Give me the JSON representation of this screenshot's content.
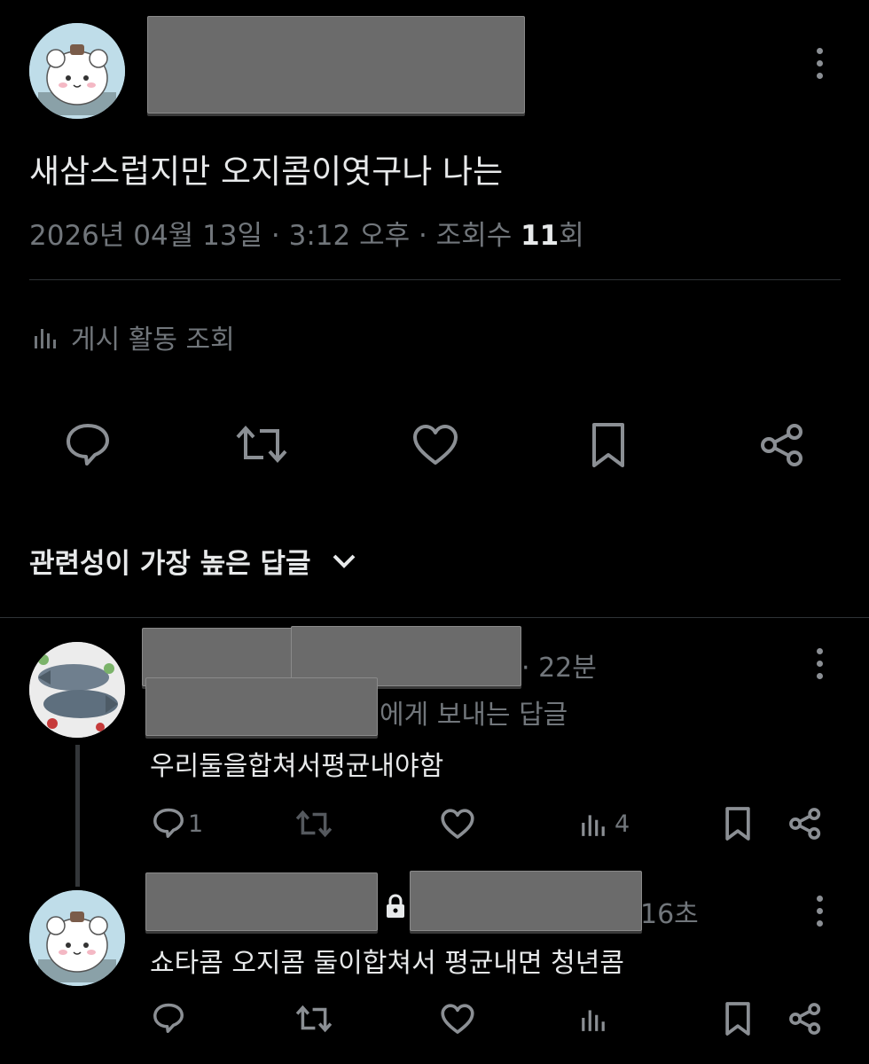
{
  "post": {
    "text": "새삼스럽지만 오지콤이엿구나 나는",
    "meta_date": "2026년 04월 13일 · 3:12 오후 · 조회수 ",
    "views": "11",
    "views_suffix": "회",
    "analytics_label": "게시 활동 조회"
  },
  "sort": {
    "label": "관련성이 가장 높은 답글"
  },
  "replies": [
    {
      "time": "· 22분",
      "replying_to": "에게 보내는 답글",
      "text": "우리둘을합쳐서평균내야함",
      "reply_count": "1",
      "views": "4"
    },
    {
      "time": "16초",
      "text": "쇼타콤 오지콤 둘이합쳐서 평균내면 청년콤"
    }
  ],
  "icons": {
    "reply": "speech-bubble-icon",
    "repost": "repost-arrows-icon",
    "like": "heart-icon",
    "bookmark": "bookmark-icon",
    "share": "share-icon",
    "views": "bar-chart-icon",
    "more": "more-vertical-icon",
    "lock": "lock-icon",
    "chevron": "chevron-down-icon"
  },
  "colors": {
    "background": "#000000",
    "text": "#e7e9ea",
    "muted": "#71767b",
    "divider": "#2f3336"
  }
}
